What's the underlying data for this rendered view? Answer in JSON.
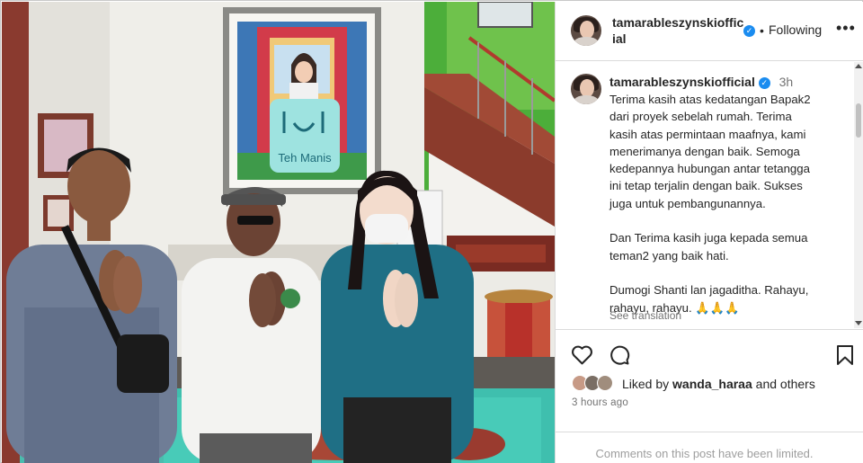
{
  "post": {
    "username": "tamarableszynskiofficial",
    "verified": true,
    "follow_status": "Following",
    "more_label": "•••",
    "caption_time": "3h",
    "caption_text": "Terima kasih atas kedatangan Bapak2\ndari proyek sebelah rumah. Terima\nkasih atas permintaan maafnya, kami\nmenerimanya dengan baik. Semoga\nkedepannya hubungan antar tetangga\nini tetap terjalin dengan baik. Sukses\njuga untuk pembangunannya.\n\nDan Terima kasih juga kepada semua\nteman2 yang baik hati.\n\nDumogi Shanti lan jagaditha. Rahayu,\nrahayu, rahayu. 🙏🙏🙏",
    "see_translation": "See translation",
    "likes_prefix": "Liked by ",
    "liked_by": "wanda_haraa",
    "likes_suffix": " and others",
    "time_ago": "3 hours ago",
    "comments_notice": "Comments on this post have been limited."
  },
  "photo": {
    "painting_sign": "Teh Manis"
  },
  "icons": {
    "verified": "verified-badge-icon",
    "like": "heart-icon",
    "comment": "comment-bubble-icon",
    "save": "bookmark-icon",
    "more": "more-options-icon"
  },
  "colors": {
    "verified_blue": "#1a8cf0",
    "text_primary": "#262626",
    "text_secondary": "#737373",
    "divider": "#dbdbdb",
    "jacket_teal": "#1f6f85"
  }
}
